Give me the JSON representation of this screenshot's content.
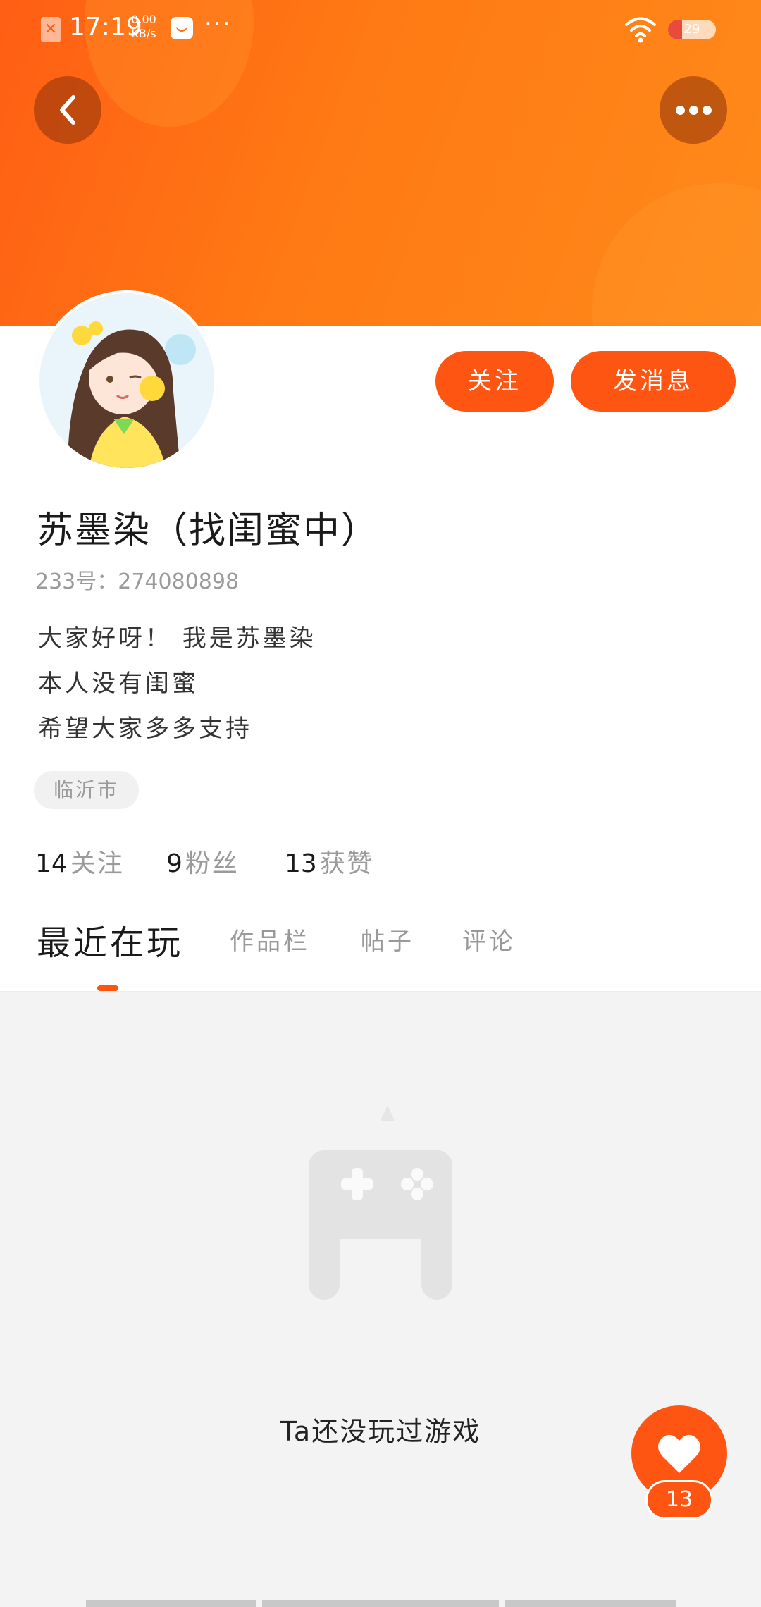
{
  "status_bar": {
    "time": "17:19",
    "net_speed_value": "0.00",
    "net_speed_unit": "KB/s",
    "more": "···",
    "battery": "29",
    "icons": [
      "sim-error-icon",
      "shopping-bag-icon",
      "wifi-icon",
      "battery-icon"
    ]
  },
  "header": {
    "back_icon": "chevron-left-icon",
    "more_icon": "more-dots-icon"
  },
  "profile": {
    "avatar": "anime-girl-avatar",
    "nickname": "苏墨染（找闺蜜中）",
    "id_label": "233号：",
    "id_value": "274080898",
    "bio": [
      "大家好呀！ 我是苏墨染",
      "本人没有闺蜜",
      "希望大家多多支持"
    ],
    "location": "临沂市"
  },
  "actions": {
    "follow_label": "关注",
    "message_label": "发消息"
  },
  "stats": [
    {
      "value": "14",
      "label": "关注"
    },
    {
      "value": "9",
      "label": "粉丝"
    },
    {
      "value": "13",
      "label": "获赞"
    }
  ],
  "tabs": [
    {
      "label": "最近在玩",
      "active": true
    },
    {
      "label": "作品栏",
      "active": false
    },
    {
      "label": "帖子",
      "active": false
    },
    {
      "label": "评论",
      "active": false
    }
  ],
  "empty_state": {
    "icon": "gamepad-icon",
    "message": "Ta还没玩过游戏"
  },
  "like": {
    "icon": "heart-icon",
    "count": "13"
  },
  "colors": {
    "accent": "#ff5512",
    "banner_start": "#ff5e14",
    "banner_end": "#ff8a1a",
    "muted_text": "#9a9a9a"
  }
}
